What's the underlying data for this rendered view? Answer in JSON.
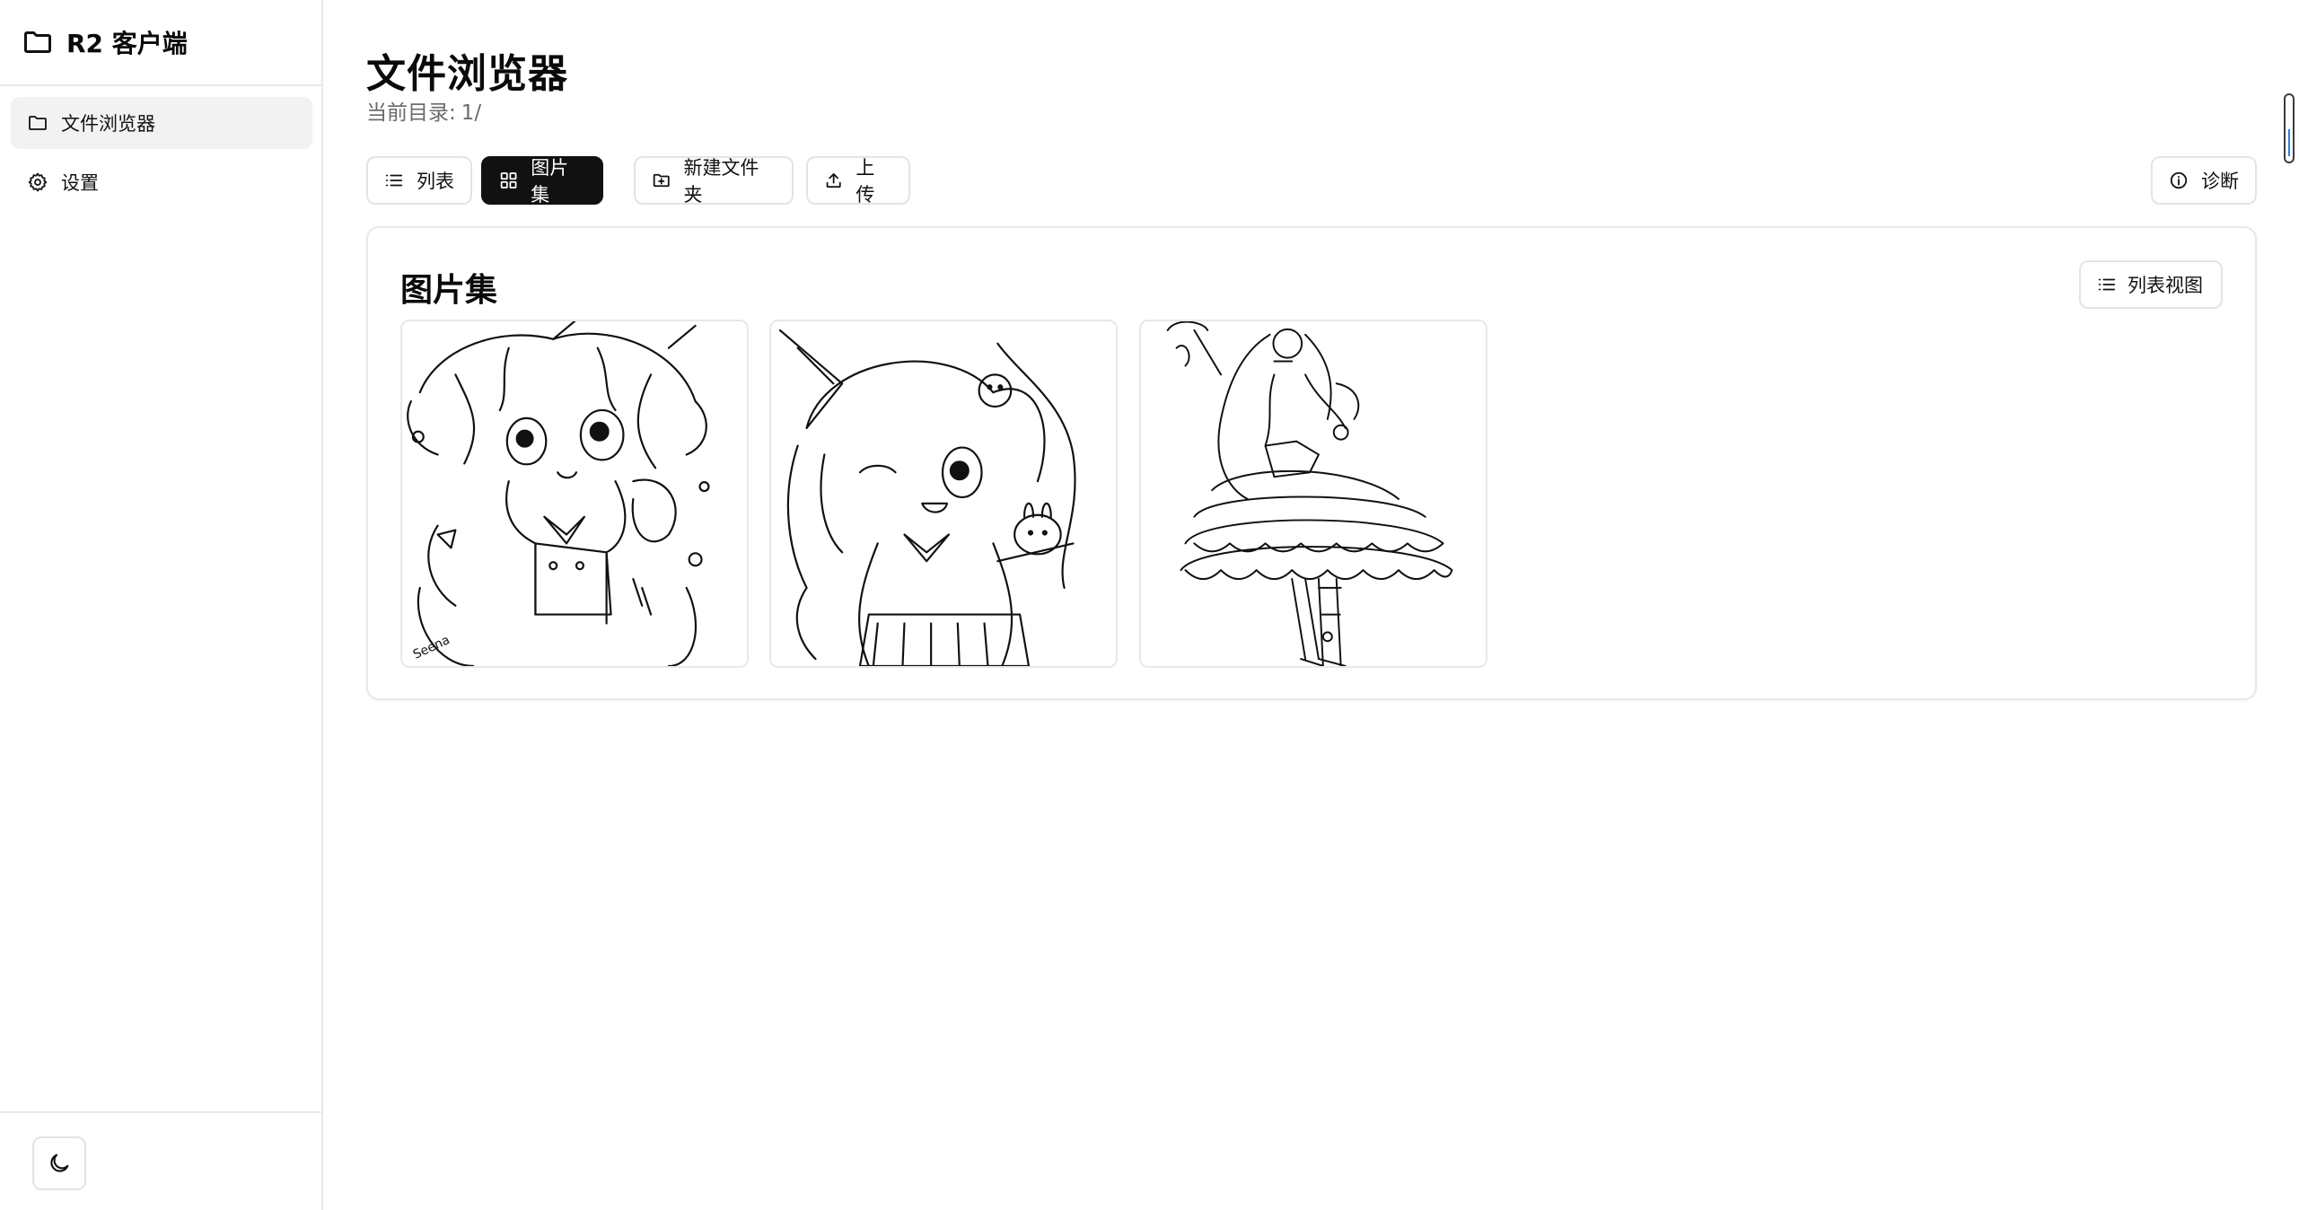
{
  "app": {
    "title": "R2 客户端"
  },
  "sidebar": {
    "items": [
      {
        "label": "文件浏览器",
        "icon": "folder-icon",
        "active": true
      },
      {
        "label": "设置",
        "icon": "gear-icon",
        "active": false
      }
    ],
    "theme_toggle_icon": "moon-icon"
  },
  "header": {
    "title": "文件浏览器",
    "current_dir_label": "当前目录:",
    "current_dir_value": "1/"
  },
  "toolbar": {
    "list_label": "列表",
    "gallery_label": "图片集",
    "new_folder_label": "新建文件夹",
    "upload_label": "上传",
    "diagnose_label": "诊断",
    "active_view": "gallery"
  },
  "gallery": {
    "title": "图片集",
    "list_view_label": "列表视图",
    "images": [
      {
        "alt": "chibi cat-ear character line art"
      },
      {
        "alt": "chibi fox-ear girl winking line art"
      },
      {
        "alt": "girl in frilled dress with parasol line art"
      }
    ]
  },
  "colors": {
    "accent": "#111111",
    "border": "#e8e8e8",
    "muted_text": "#6b6b6b",
    "active_nav_bg": "#f2f2f2"
  }
}
